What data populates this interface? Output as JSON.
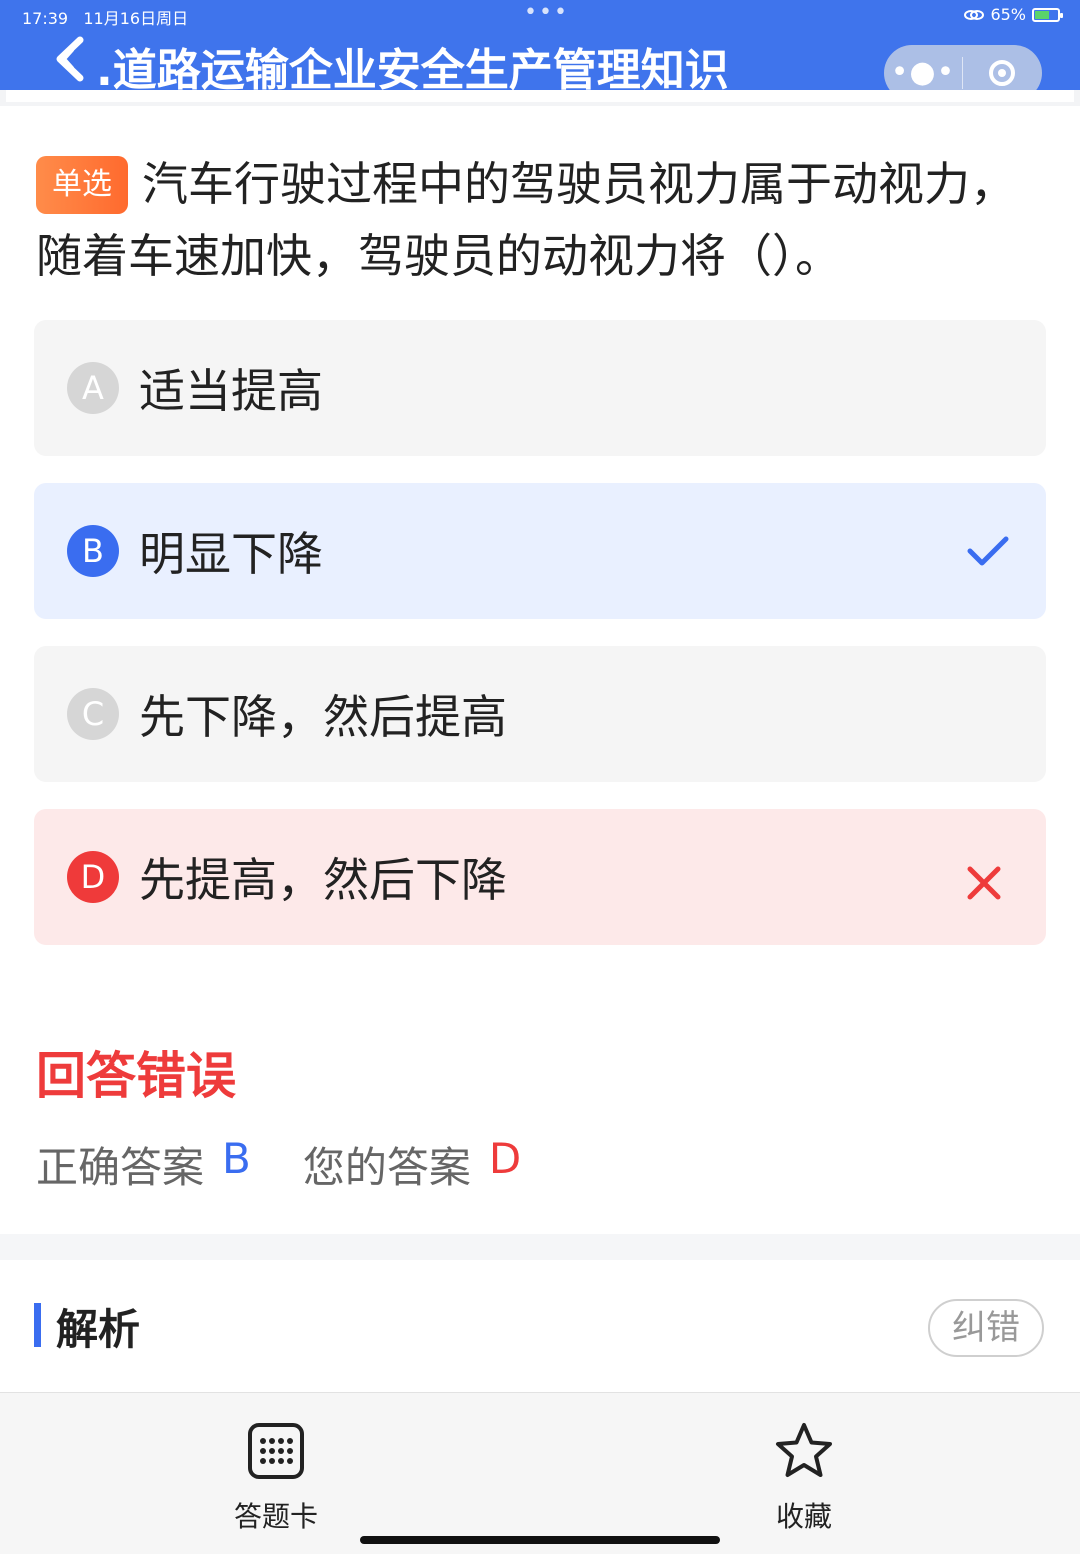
{
  "status_bar": {
    "time": "17:39",
    "date": "11月16日周日",
    "battery": "65%",
    "battery_level": 0.65
  },
  "header": {
    "title": ".道路运输企业安全生产管理知识",
    "more_icon": "more-dots-icon",
    "close_icon": "target-icon",
    "background": "#3f74ec"
  },
  "question": {
    "type_tag": "单选",
    "text": "汽车行驶过程中的驾驶员视力属于动视力，随着车速加快，驾驶员的动视力将（）。"
  },
  "options": [
    {
      "letter": "A",
      "text": "适当提高",
      "state": "normal"
    },
    {
      "letter": "B",
      "text": "明显下降",
      "state": "correct"
    },
    {
      "letter": "C",
      "text": "先下降，然后提高",
      "state": "normal"
    },
    {
      "letter": "D",
      "text": "先提高，然后下降",
      "state": "wrong"
    }
  ],
  "result": {
    "title": "回答错误",
    "correct_label": "正确答案",
    "correct_value": "B",
    "your_label": "您的答案",
    "your_value": "D"
  },
  "analysis": {
    "title": "解析",
    "report_button": "纠错"
  },
  "bottom_bar": {
    "answer_card": "答题卡",
    "favorite": "收藏"
  },
  "colors": {
    "accent_blue": "#3a6df0",
    "error_red": "#ee3b3b",
    "tag_orange": "#ff7a3a"
  }
}
